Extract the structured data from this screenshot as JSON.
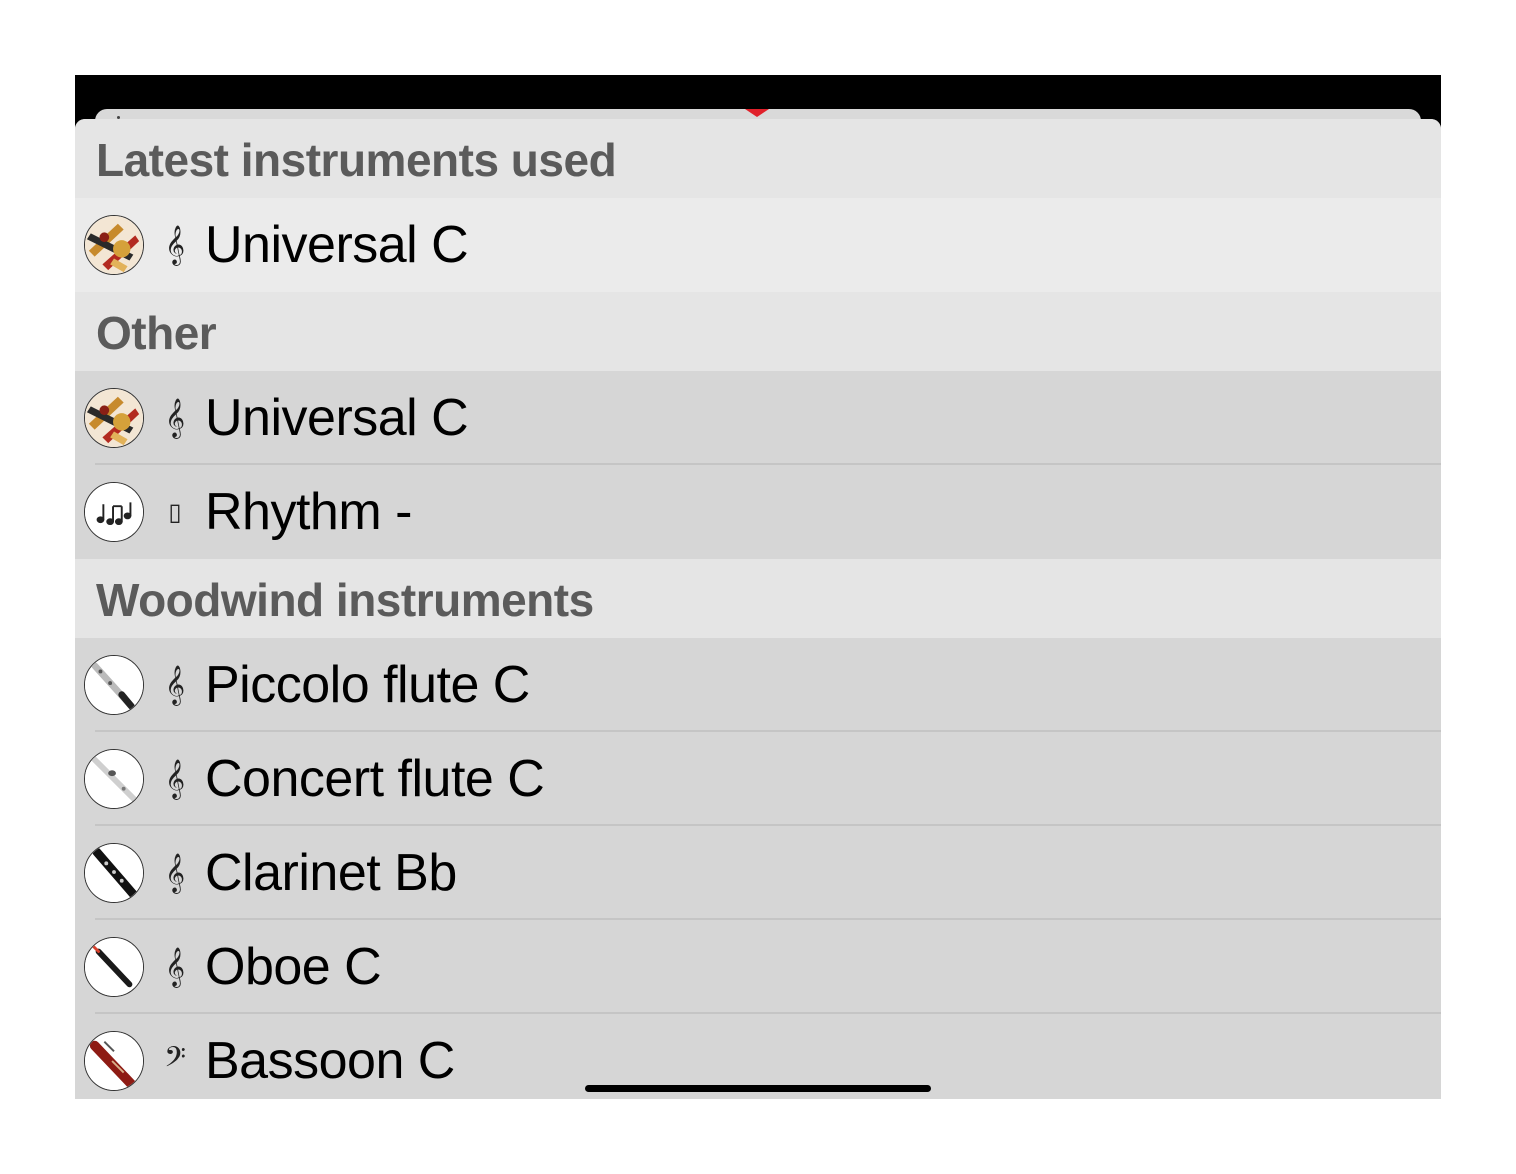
{
  "sections": [
    {
      "title": "Latest instruments used",
      "items": [
        {
          "label": "Universal C",
          "clef": "𝄞",
          "icon": "universal-instruments-icon"
        }
      ]
    },
    {
      "title": "Other",
      "items": [
        {
          "label": "Universal C",
          "clef": "𝄞",
          "icon": "universal-instruments-icon"
        },
        {
          "label": "Rhythm -",
          "clef": "▯",
          "icon": "rhythm-notes-icon"
        }
      ]
    },
    {
      "title": "Woodwind instruments",
      "items": [
        {
          "label": "Piccolo flute C",
          "clef": "𝄞",
          "icon": "piccolo-flute-icon"
        },
        {
          "label": "Concert flute C",
          "clef": "𝄞",
          "icon": "concert-flute-icon"
        },
        {
          "label": "Clarinet Bb",
          "clef": "𝄞",
          "icon": "clarinet-icon"
        },
        {
          "label": "Oboe C",
          "clef": "𝄞",
          "icon": "oboe-icon"
        },
        {
          "label": "Bassoon C",
          "clef": "𝄢",
          "icon": "bassoon-icon"
        }
      ]
    }
  ],
  "colors": {
    "header_background": "#e5e5e5",
    "row_background": "#d6d6d6",
    "latest_row_background": "#ebebeb",
    "header_text": "#5b5b5b",
    "accent_red": "#e0202a"
  }
}
